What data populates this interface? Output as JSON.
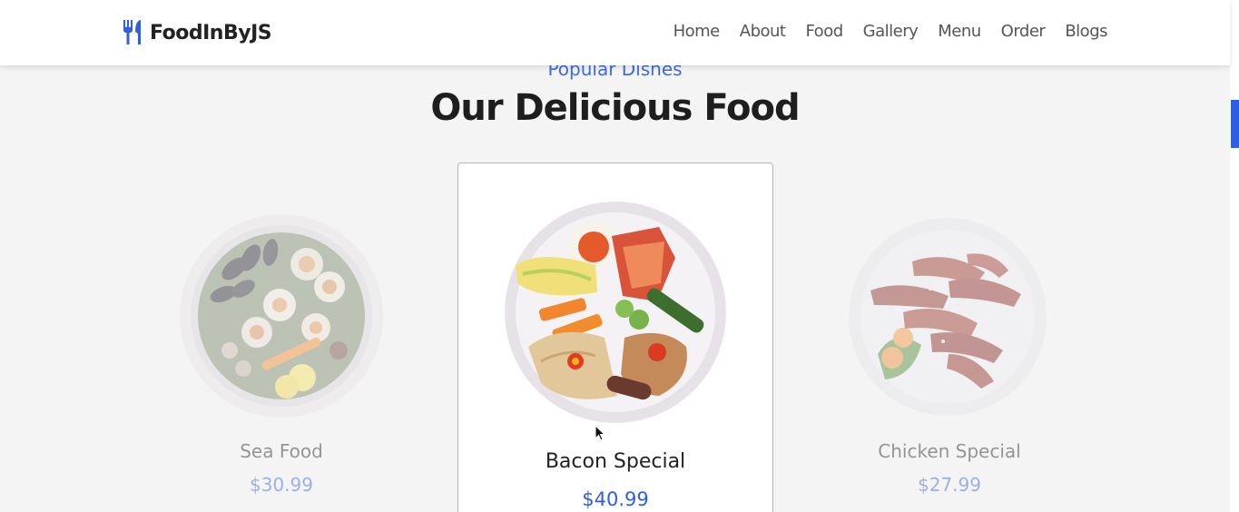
{
  "brand": {
    "name": "FoodInByJS",
    "icon": "utensils-icon",
    "accent": "#2f5fe0"
  },
  "nav": [
    "Home",
    "About",
    "Food",
    "Gallery",
    "Menu",
    "Order",
    "Blogs"
  ],
  "section": {
    "subtitle": "Popular Dishes",
    "title": "Our Delicious Food"
  },
  "dishes": [
    {
      "name": "Sea Food",
      "price": "$30.99",
      "image": "seafood-plate-image",
      "active": false
    },
    {
      "name": "Bacon Special",
      "price": "$40.99",
      "image": "bacon-special-plate-image",
      "active": true
    },
    {
      "name": "Chicken Special",
      "price": "$27.99",
      "image": "chicken-special-plate-image",
      "active": false
    }
  ],
  "colors": {
    "accent": "#2f5fe0",
    "background": "#f4f4f4",
    "header": "#ffffff"
  }
}
